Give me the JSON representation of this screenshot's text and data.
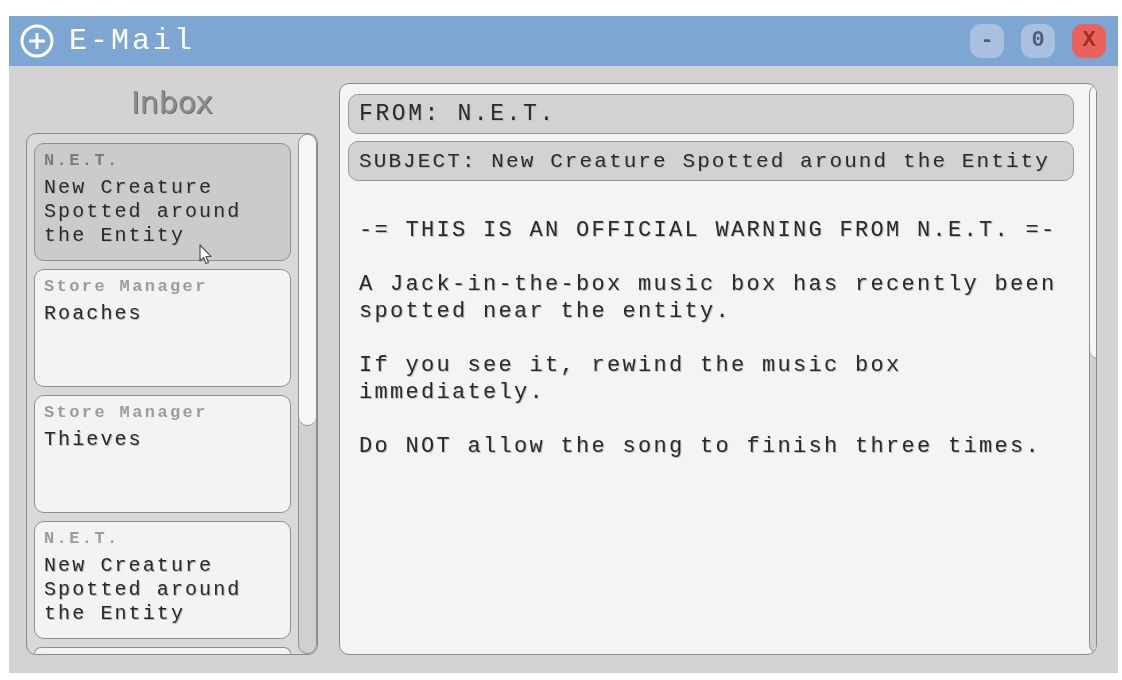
{
  "window": {
    "title": "E-Mail",
    "buttons": [
      {
        "kind": "minimize",
        "label": "-"
      },
      {
        "kind": "maximize",
        "label": "0"
      },
      {
        "kind": "close",
        "label": "X"
      }
    ]
  },
  "inbox": {
    "title": "Inbox",
    "messages": [
      {
        "sender": "N.E.T.",
        "subject": "New Creature Spotted around the Entity",
        "selected": true
      },
      {
        "sender": "Store Manager",
        "subject": "Roaches",
        "selected": false
      },
      {
        "sender": "Store Manager",
        "subject": "Thieves",
        "selected": false
      },
      {
        "sender": "N.E.T.",
        "subject": "New Creature Spotted around the Entity",
        "selected": false
      }
    ]
  },
  "message": {
    "from": "FROM: N.E.T.",
    "subject": "SUBJECT: New Creature Spotted around the Entity",
    "body": [
      "-= THIS IS AN OFFICIAL WARNING FROM N.E.T. =-",
      "A Jack-in-the-box music box has recently been spotted near the entity.",
      "If you see it, rewind the music box immediately.",
      "Do NOT allow the song to finish three times."
    ]
  }
}
